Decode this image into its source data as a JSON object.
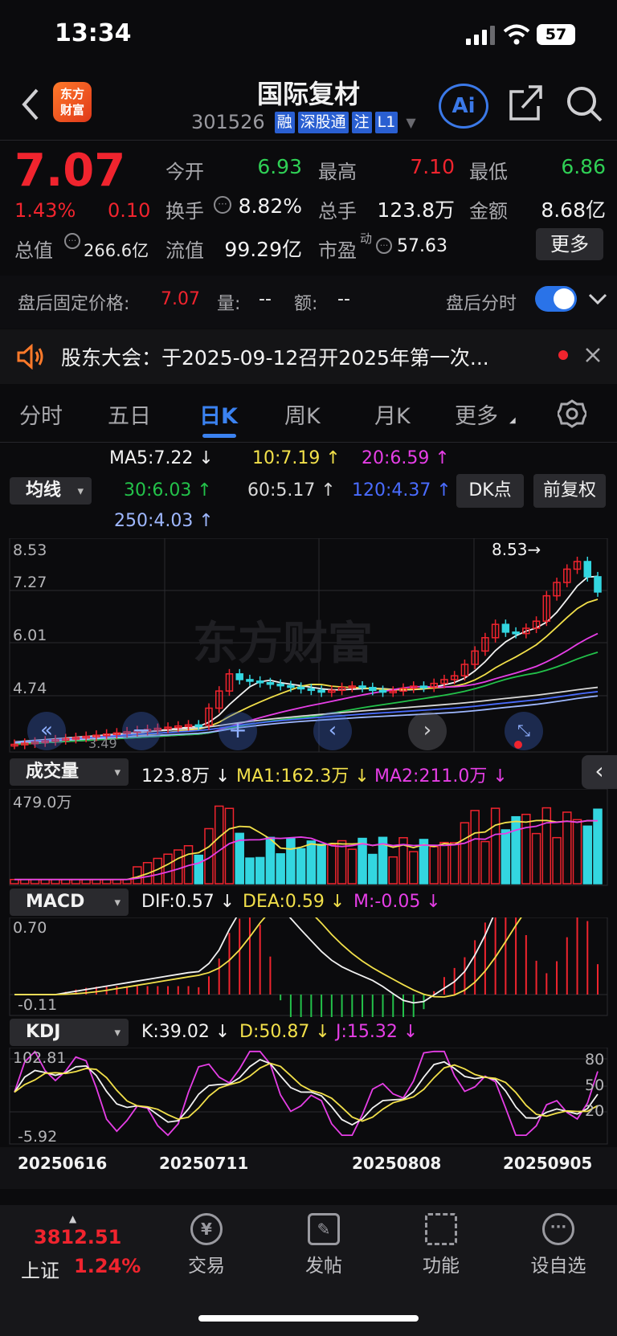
{
  "status": {
    "time": "13:34",
    "battery": "57"
  },
  "header": {
    "brand_logo": "东方财富",
    "stock_name": "国际复材",
    "stock_code": "301526",
    "tags": [
      "融",
      "深股通",
      "注",
      "L1"
    ],
    "ai_label": "Ai",
    "icons": [
      "back-icon",
      "share-icon",
      "search-icon"
    ]
  },
  "quote": {
    "price": "7.07",
    "pct": "1.43%",
    "change": "0.10",
    "rows": [
      [
        {
          "label": "今开",
          "value": "6.93",
          "color": "green"
        },
        {
          "label": "最高",
          "value": "7.10",
          "color": "red"
        },
        {
          "label": "最低",
          "value": "6.86",
          "color": "green"
        }
      ],
      [
        {
          "label": "换手",
          "value": "8.82%",
          "color": "white"
        },
        {
          "label": "总手",
          "value": "123.8万",
          "color": "white"
        },
        {
          "label": "金额",
          "value": "8.68亿",
          "color": "white"
        }
      ]
    ],
    "total_cap_label": "总值",
    "total_cap_value": "266.6亿",
    "float_cap_label": "流值",
    "float_cap_value": "99.29亿",
    "pe_label": "市盈",
    "pe_sup": "动",
    "pe_value": "57.63",
    "more_label": "更多"
  },
  "after_hours": {
    "label": "盘后固定价格:",
    "price": "7.07",
    "vol_label": "量:",
    "vol_value": "--",
    "amt_label": "额:",
    "amt_value": "--",
    "timeshare_label": "盘后分时"
  },
  "notice": {
    "text": "股东大会：于2025-09-12召开2025年第一次..."
  },
  "tabs": [
    "分时",
    "五日",
    "日K",
    "周K",
    "月K",
    "更多"
  ],
  "ma": {
    "dropdown": "均线",
    "items": [
      {
        "text": "MA5:7.22 ↓",
        "color": "#f2f2f2"
      },
      {
        "text": "10:7.19 ↑",
        "color": "#f2e04a"
      },
      {
        "text": "20:6.59 ↑",
        "color": "#e63ee6"
      },
      {
        "text": "30:6.03 ↑",
        "color": "#23c24a"
      },
      {
        "text": "60:5.17 ↑",
        "color": "#d8d8d8"
      },
      {
        "text": "120:4.37 ↑",
        "color": "#4a6cff"
      },
      {
        "text": "250:4.03 ↑",
        "color": "#9fb8ff"
      }
    ],
    "dk_label": "DK点",
    "adjust_label": "前复权"
  },
  "kline": {
    "axis": [
      "8.53",
      "7.27",
      "6.01",
      "4.74"
    ],
    "high_marker": "8.53→",
    "low_marker": "3.49",
    "watermark": "东方财富"
  },
  "volume": {
    "dropdown": "成交量",
    "value": "123.8万 ↓",
    "ma1": "MA1:162.3万 ↓",
    "ma2": "MA2:211.0万 ↓",
    "axis_top": "479.0万"
  },
  "macd": {
    "dropdown": "MACD",
    "dif": "DIF:0.57 ↓",
    "dea": "DEA:0.59 ↓",
    "m": "M:-0.05 ↓",
    "axis_top": "0.70",
    "axis_bottom": "-0.11"
  },
  "kdj": {
    "dropdown": "KDJ",
    "k": "K:39.02 ↓",
    "d": "D:50.87 ↓",
    "j": "J:15.32 ↓",
    "axis_top": "102.81",
    "axis_bottom": "-5.92",
    "levels": [
      "80",
      "50",
      "20"
    ]
  },
  "dates": [
    "20250616",
    "20250711",
    "20250808",
    "20250905"
  ],
  "bottom_nav": {
    "index_value": "3812.51",
    "index_name": "上证",
    "index_pct": "1.24%",
    "items": [
      "交易",
      "发帖",
      "功能",
      "设自选"
    ]
  }
}
